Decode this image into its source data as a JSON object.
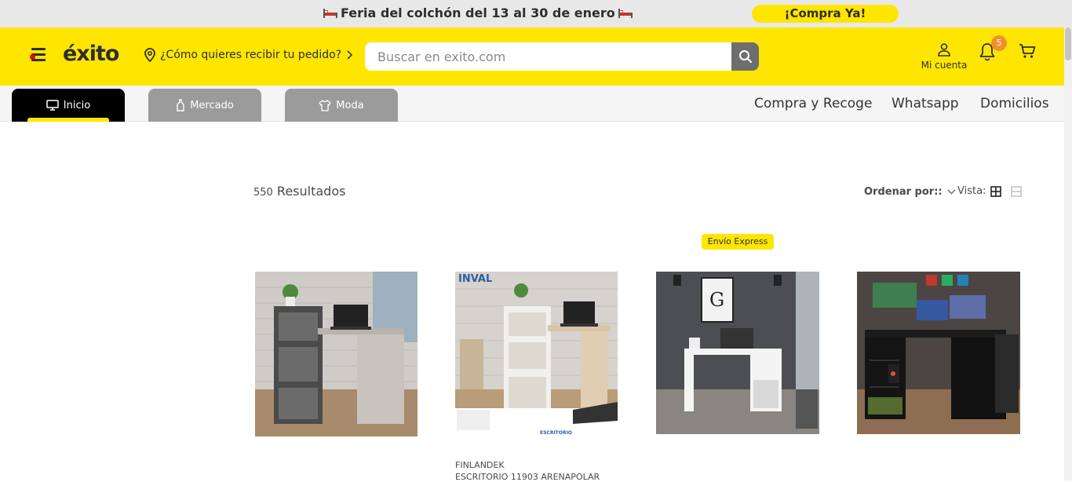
{
  "promo": {
    "text": "Feria del colchón del 13 al 30 de enero",
    "cta": "¡Compra Ya!"
  },
  "header": {
    "logo": "éxito",
    "location_prompt": "¿Cómo quieres recibir tu pedido?",
    "search_placeholder": "Buscar en exito.com",
    "account_label": "Mi cuenta",
    "notifications_count": "5"
  },
  "nav": {
    "tabs": [
      {
        "label": "Inicio",
        "icon": "monitor-icon",
        "active": true
      },
      {
        "label": "Mercado",
        "icon": "bottle-icon",
        "active": false
      },
      {
        "label": "Moda",
        "icon": "shirt-icon",
        "active": false
      }
    ],
    "links": [
      "Compra y Recoge",
      "Whatsapp",
      "Domicilios"
    ]
  },
  "results": {
    "count": "550",
    "label": "Resultados",
    "sort_label": "Ordenar por::",
    "view_label": "Vista:"
  },
  "products": [
    {
      "badge": "",
      "brand": "",
      "name": ""
    },
    {
      "badge": "",
      "brand": "FINLANDEK",
      "name": "ESCRITORIO 11903 ARENAPOLAR",
      "img_brand": "INVAL",
      "img_caption": "ESCRITORIO"
    },
    {
      "badge": "Envío Express",
      "brand": "",
      "name": ""
    },
    {
      "badge": "",
      "brand": "",
      "name": ""
    }
  ],
  "colors": {
    "brand_yellow": "#ffe600",
    "dark": "#2e2e2e",
    "badge_orange": "#f0912b"
  }
}
